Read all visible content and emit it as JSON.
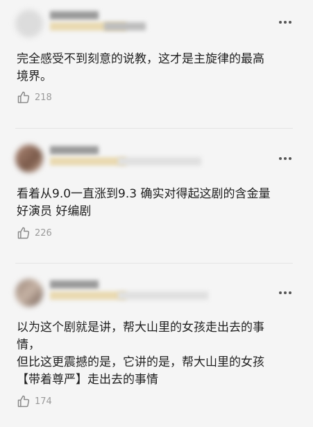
{
  "comments": [
    {
      "text": "完全感受不到刻意的说教，这才是主旋律的最高\n境界。",
      "likes": "218",
      "like_icon": "thumbs-up-icon",
      "more_icon": "more-dots-icon"
    },
    {
      "text": "看着从9.0一直涨到9.3 确实对得起这剧的含金量\n好演员 好编剧",
      "likes": "226",
      "like_icon": "thumbs-up-icon",
      "more_icon": "more-dots-icon"
    },
    {
      "text": "以为这个剧就是讲，帮大山里的女孩走出去的事\n情，\n但比这更震撼的是，它讲的是，帮大山里的女孩\n【带着尊严】走出去的事情",
      "likes": "174",
      "like_icon": "thumbs-up-icon",
      "more_icon": "more-dots-icon"
    }
  ],
  "colors": {
    "background": "#f5f5f5",
    "text": "#1f1f1f",
    "meta": "#9a9a9a"
  }
}
